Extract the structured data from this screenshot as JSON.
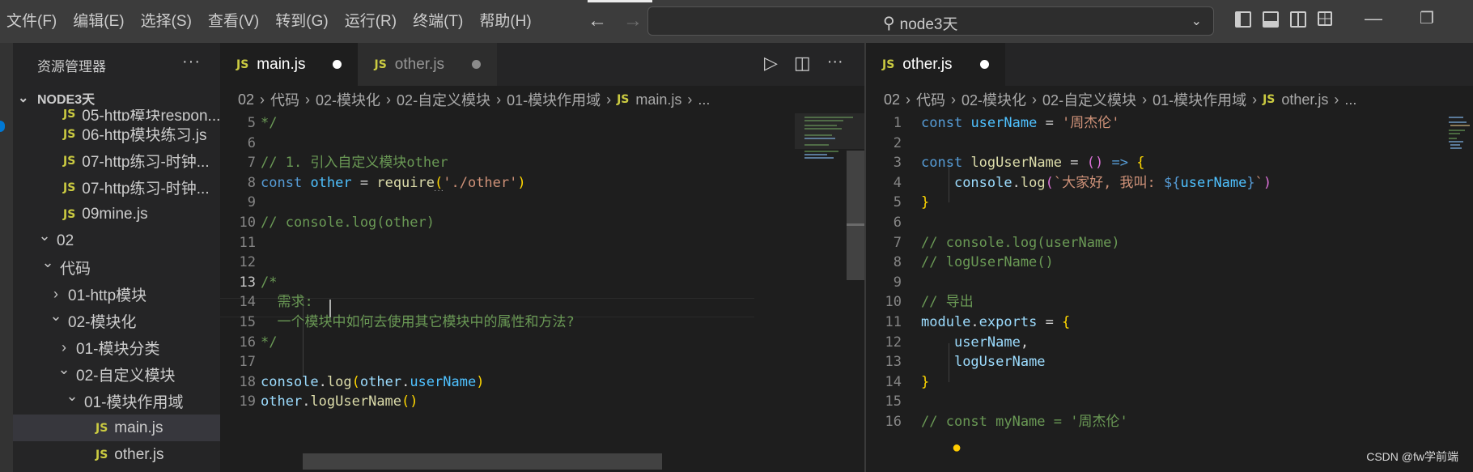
{
  "menu": [
    "文件(F)",
    "编辑(E)",
    "选择(S)",
    "查看(V)",
    "转到(G)",
    "运行(R)",
    "终端(T)",
    "帮助(H)"
  ],
  "search": {
    "text": "node3天"
  },
  "explorer": {
    "title": "资源管理器",
    "more": "···",
    "root": "NODE3天",
    "items": [
      {
        "label": "05-http模块respon...",
        "type": "file",
        "indent": 1
      },
      {
        "label": "06-http模块练习.js",
        "type": "file",
        "indent": 1
      },
      {
        "label": "07-http练习-时钟...",
        "type": "file",
        "indent": 1
      },
      {
        "label": "07-http练习-时钟...",
        "type": "file",
        "indent": 1
      },
      {
        "label": "09mine.js",
        "type": "file",
        "indent": 1
      },
      {
        "label": "02",
        "type": "folder-open",
        "indent": 0
      },
      {
        "label": "代码",
        "type": "folder-open",
        "indent": 1
      },
      {
        "label": "01-http模块",
        "type": "folder-closed",
        "indent": 2
      },
      {
        "label": "02-模块化",
        "type": "folder-open",
        "indent": 2
      },
      {
        "label": "01-模块分类",
        "type": "folder-closed",
        "indent": 3
      },
      {
        "label": "02-自定义模块",
        "type": "folder-open",
        "indent": 3
      },
      {
        "label": "01-模块作用域",
        "type": "folder-open",
        "indent": 4
      },
      {
        "label": "main.js",
        "type": "file",
        "indent": 5,
        "selected": true
      },
      {
        "label": "other.js",
        "type": "file",
        "indent": 5
      }
    ]
  },
  "left_editor": {
    "tabs": [
      {
        "label": "main.js",
        "active": true
      },
      {
        "label": "other.js",
        "active": false
      }
    ],
    "breadcrumb": [
      "02",
      "代码",
      "02-模块化",
      "02-自定义模块",
      "01-模块作用域"
    ],
    "breadcrumb_file": "main.js",
    "breadcrumb_tail": "...",
    "current_line": 13,
    "lines": [
      {
        "n": "5",
        "code": [
          [
            "c-com",
            "*/"
          ]
        ]
      },
      {
        "n": "6",
        "code": []
      },
      {
        "n": "7",
        "code": [
          [
            "c-com",
            "// 1. 引入自定义模块other"
          ]
        ]
      },
      {
        "n": "8",
        "code": [
          [
            "c-kw",
            "const"
          ],
          [
            "c-punc",
            " "
          ],
          [
            "c-const",
            "other"
          ],
          [
            "c-punc",
            " = "
          ],
          [
            "c-fn",
            "require"
          ],
          [
            "c-br1",
            "("
          ],
          [
            "c-str",
            "'./other'"
          ],
          [
            "c-br1",
            ")"
          ]
        ]
      },
      {
        "n": "9",
        "code": []
      },
      {
        "n": "10",
        "code": [
          [
            "c-com",
            "// console.log(other)"
          ]
        ]
      },
      {
        "n": "11",
        "code": []
      },
      {
        "n": "12",
        "code": []
      },
      {
        "n": "13",
        "code": [
          [
            "c-com",
            "/* "
          ]
        ]
      },
      {
        "n": "14",
        "code": [
          [
            "c-com",
            "  需求:"
          ]
        ]
      },
      {
        "n": "15",
        "code": [
          [
            "c-com",
            "  一个模块中如何去使用其它模块中的属性和方法?"
          ]
        ]
      },
      {
        "n": "16",
        "code": [
          [
            "c-com",
            "*/"
          ]
        ]
      },
      {
        "n": "17",
        "code": []
      },
      {
        "n": "18",
        "code": [
          [
            "c-var",
            "console"
          ],
          [
            "c-punc",
            "."
          ],
          [
            "c-fn",
            "log"
          ],
          [
            "c-br1",
            "("
          ],
          [
            "c-var",
            "other"
          ],
          [
            "c-punc",
            "."
          ],
          [
            "c-const",
            "userName"
          ],
          [
            "c-br1",
            ")"
          ]
        ]
      },
      {
        "n": "19",
        "code": [
          [
            "c-var",
            "other"
          ],
          [
            "c-punc",
            "."
          ],
          [
            "c-fn",
            "logUserName"
          ],
          [
            "c-br1",
            "()"
          ]
        ]
      }
    ]
  },
  "right_editor": {
    "tabs": [
      {
        "label": "other.js",
        "active": true
      }
    ],
    "breadcrumb": [
      "02",
      "代码",
      "02-模块化",
      "02-自定义模块",
      "01-模块作用域"
    ],
    "breadcrumb_file": "other.js",
    "breadcrumb_tail": "...",
    "lines": [
      {
        "n": "1",
        "code": [
          [
            "c-kw",
            "const"
          ],
          [
            "c-punc",
            " "
          ],
          [
            "c-const",
            "userName"
          ],
          [
            "c-punc",
            " = "
          ],
          [
            "c-str",
            "'周杰伦'"
          ]
        ]
      },
      {
        "n": "2",
        "code": []
      },
      {
        "n": "3",
        "code": [
          [
            "c-kw",
            "const"
          ],
          [
            "c-punc",
            " "
          ],
          [
            "c-fn",
            "logUserName"
          ],
          [
            "c-punc",
            " = "
          ],
          [
            "c-br2",
            "()"
          ],
          [
            "c-punc",
            " "
          ],
          [
            "c-kw",
            "=>"
          ],
          [
            "c-punc",
            " "
          ],
          [
            "c-br1",
            "{"
          ]
        ]
      },
      {
        "n": "4",
        "code": [
          [
            "c-punc",
            "    "
          ],
          [
            "c-var",
            "console"
          ],
          [
            "c-punc",
            "."
          ],
          [
            "c-fn",
            "log"
          ],
          [
            "c-br2",
            "("
          ],
          [
            "c-str",
            "`大家好, 我叫: "
          ],
          [
            "c-kw",
            "${"
          ],
          [
            "c-const",
            "userName"
          ],
          [
            "c-kw",
            "}"
          ],
          [
            "c-str",
            "`"
          ],
          [
            "c-br2",
            ")"
          ]
        ]
      },
      {
        "n": "5",
        "code": [
          [
            "c-br1",
            "}"
          ]
        ]
      },
      {
        "n": "6",
        "code": []
      },
      {
        "n": "7",
        "code": [
          [
            "c-com",
            "// console.log(userName)"
          ]
        ]
      },
      {
        "n": "8",
        "code": [
          [
            "c-com",
            "// logUserName()"
          ]
        ]
      },
      {
        "n": "9",
        "code": []
      },
      {
        "n": "10",
        "code": [
          [
            "c-com",
            "// 导出"
          ]
        ]
      },
      {
        "n": "11",
        "code": [
          [
            "c-var",
            "module"
          ],
          [
            "c-punc",
            "."
          ],
          [
            "c-var",
            "exports"
          ],
          [
            "c-punc",
            " = "
          ],
          [
            "c-br1",
            "{"
          ]
        ]
      },
      {
        "n": "12",
        "code": [
          [
            "c-punc",
            "    "
          ],
          [
            "c-var",
            "userName"
          ],
          [
            "c-punc",
            ","
          ]
        ]
      },
      {
        "n": "13",
        "code": [
          [
            "c-punc",
            "    "
          ],
          [
            "c-var",
            "logUserName"
          ]
        ]
      },
      {
        "n": "14",
        "code": [
          [
            "c-br1",
            "}"
          ]
        ]
      },
      {
        "n": "15",
        "code": []
      },
      {
        "n": "16",
        "code": [
          [
            "c-com",
            "// const myName = '周杰伦'"
          ]
        ]
      }
    ]
  },
  "icons": {
    "search": "search-icon",
    "run": "run-icon",
    "split": "split-editor-icon",
    "lightbulb": "lightbulb-icon"
  },
  "watermark": "CSDN @fw学前端"
}
